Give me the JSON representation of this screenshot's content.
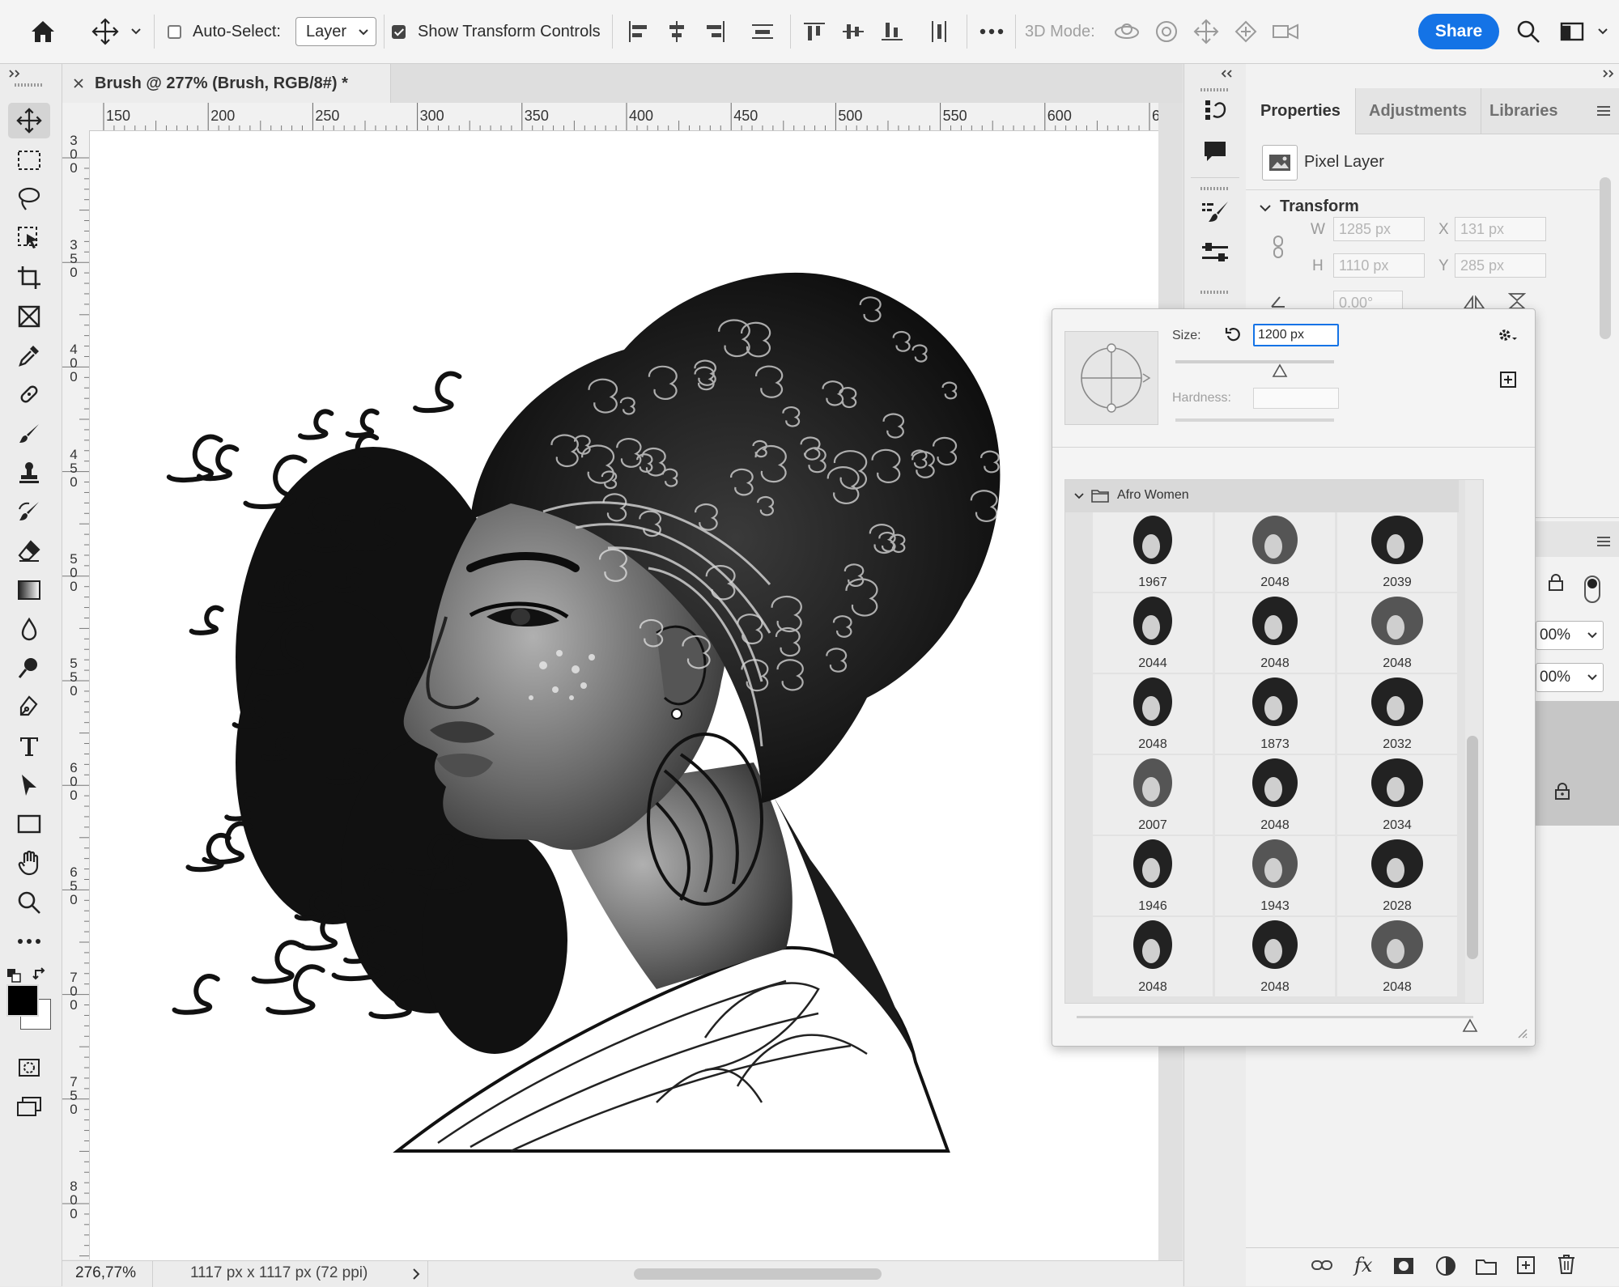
{
  "options_bar": {
    "auto_select_label": "Auto-Select:",
    "auto_select_checked": false,
    "layer_select_value": "Layer",
    "show_transform_label": "Show Transform Controls",
    "show_transform_checked": true,
    "mode_3d_label": "3D Mode:",
    "share_label": "Share"
  },
  "document": {
    "tab_title": "Brush @ 277% (Brush, RGB/8#) *",
    "zoom": "276,77%",
    "doc_info": "1117 px x 1117 px (72 ppi)"
  },
  "rulers": {
    "top": [
      "150",
      "200",
      "250",
      "300",
      "350",
      "400",
      "450",
      "500",
      "550",
      "600",
      "6"
    ],
    "left": [
      "300",
      "350",
      "400",
      "450",
      "500",
      "550",
      "600",
      "650",
      "700",
      "750",
      "800"
    ]
  },
  "properties": {
    "tabs": [
      "Properties",
      "Adjustments",
      "Libraries"
    ],
    "layer_type": "Pixel Layer",
    "transform_title": "Transform",
    "w_label": "W",
    "w_value": "1285 px",
    "x_label": "X",
    "x_value": "131 px",
    "h_label": "H",
    "h_value": "1110 px",
    "y_label": "Y",
    "y_value": "285 px",
    "angle_value": "0.00°",
    "opacity_value_1": "00%",
    "opacity_value_2": "00%"
  },
  "brush_panel": {
    "size_label": "Size:",
    "size_value": "1200 px",
    "size_fraction": 0.66,
    "hardness_label": "Hardness:",
    "hardness_value": "",
    "folder_name": "Afro Women",
    "presets": [
      "1967",
      "2048",
      "2039",
      "2044",
      "2048",
      "2048",
      "2048",
      "1873",
      "2032",
      "2007",
      "2048",
      "2034",
      "1946",
      "1943",
      "2028",
      "2048",
      "2048",
      "2048"
    ]
  },
  "colors": {
    "accent": "#1473e6",
    "foreground": "#000000",
    "background": "#ffffff"
  }
}
